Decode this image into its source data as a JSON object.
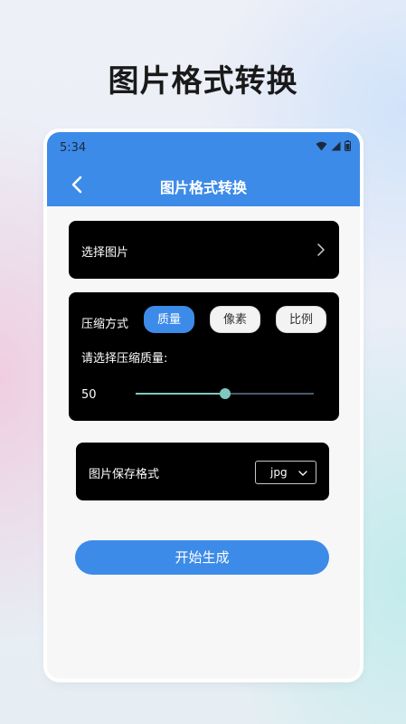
{
  "promo": {
    "title": "图片格式转换"
  },
  "status_bar": {
    "time": "5:34",
    "icons": [
      "wifi-icon",
      "signal-icon",
      "battery-icon"
    ]
  },
  "app_bar": {
    "title": "图片格式转换",
    "back_icon": "chevron-left-icon"
  },
  "select_image": {
    "label": "选择图片",
    "icon": "chevron-right-icon"
  },
  "compression": {
    "label": "压缩方式",
    "options": [
      "质量",
      "像素",
      "比例"
    ],
    "selected": "质量",
    "quality_prompt": "请选择压缩质量:",
    "quality_value": "50",
    "slider_fraction": 0.5
  },
  "save_format": {
    "label": "图片保存格式",
    "value": "jpg"
  },
  "start_button": {
    "label": "开始生成"
  },
  "colors": {
    "accent": "#3d8be8",
    "card": "#000000",
    "slider": "#7ec8c0"
  }
}
